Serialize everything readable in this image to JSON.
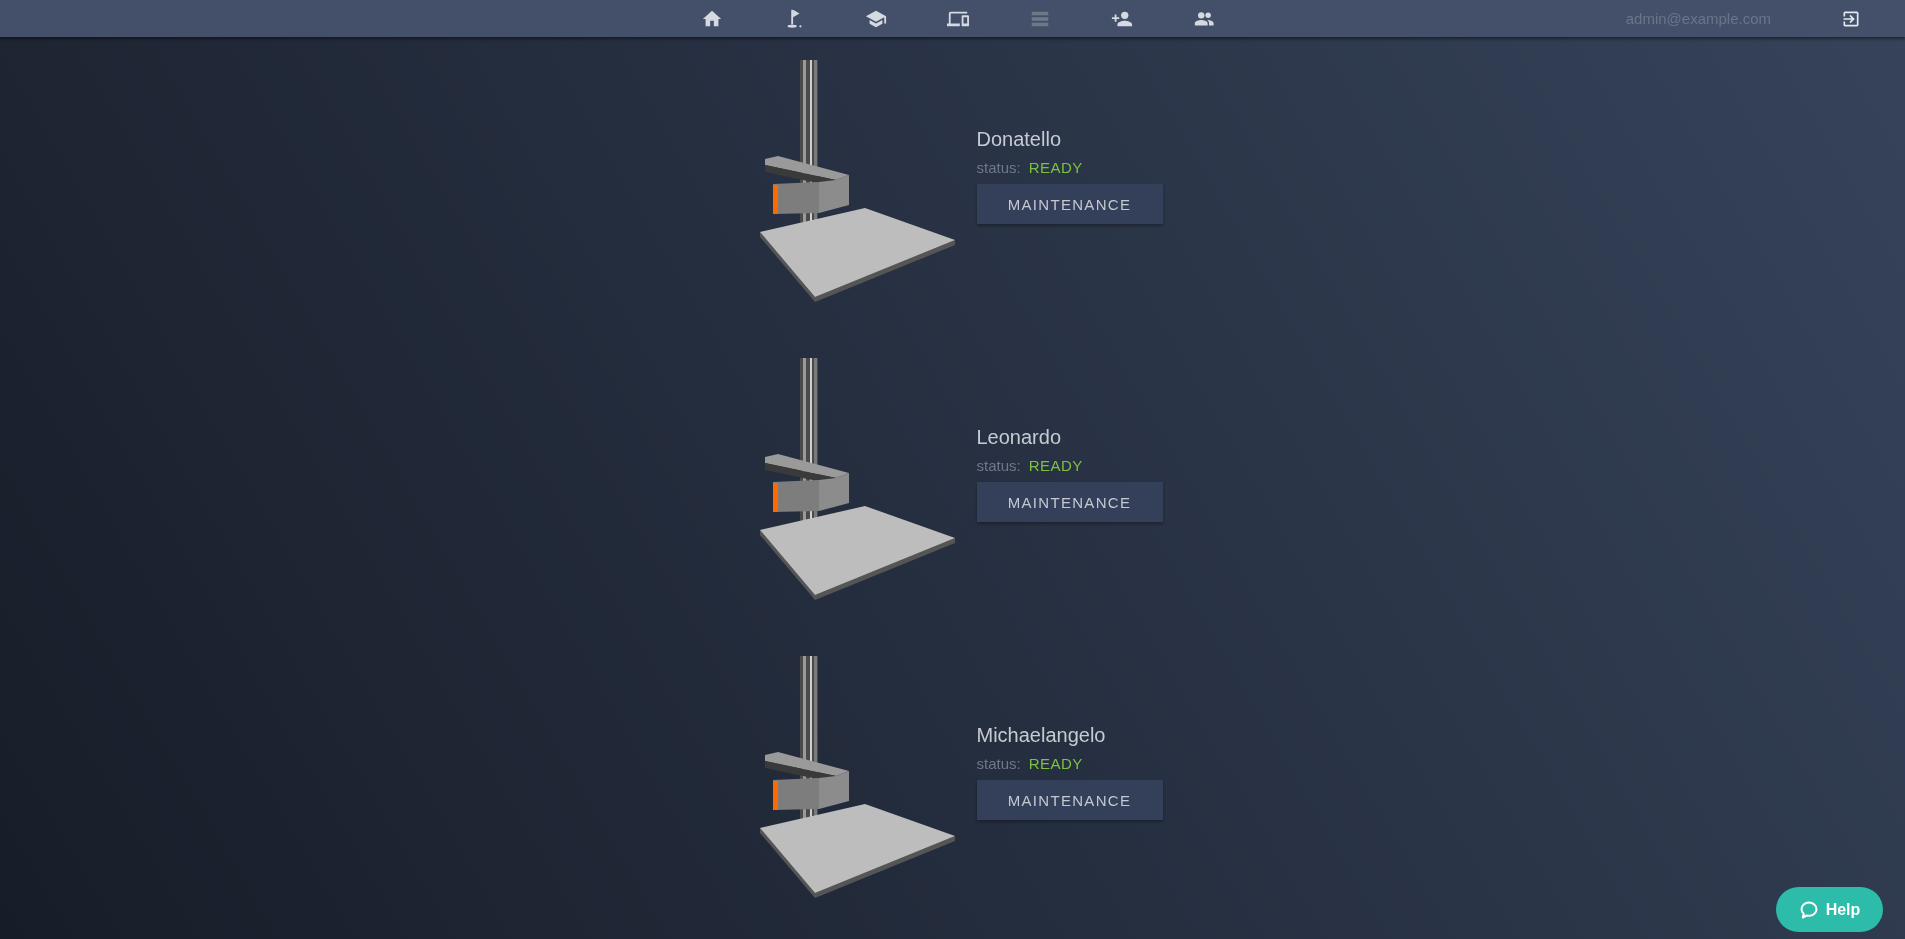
{
  "nav": {
    "items": [
      {
        "kind": "home",
        "disabled": false
      },
      {
        "kind": "flag",
        "disabled": false
      },
      {
        "kind": "school",
        "disabled": false
      },
      {
        "kind": "devices",
        "disabled": false
      },
      {
        "kind": "list",
        "disabled": true
      },
      {
        "kind": "person-add",
        "disabled": false
      },
      {
        "kind": "people",
        "disabled": false
      }
    ],
    "user": "admin@example.com",
    "logout": {
      "kind": "exit"
    }
  },
  "printers": [
    {
      "name": "Donatello",
      "status_label": "status:",
      "status": "READY",
      "color": "#7cc242",
      "button": "MAINTENANCE"
    },
    {
      "name": "Leonardo",
      "status_label": "status:",
      "status": "READY",
      "color": "#7cc242",
      "button": "MAINTENANCE"
    },
    {
      "name": "Michaelangelo",
      "status_label": "status:",
      "status": "READY",
      "color": "#7cc242",
      "button": "MAINTENANCE"
    }
  ],
  "help_button": "Help"
}
